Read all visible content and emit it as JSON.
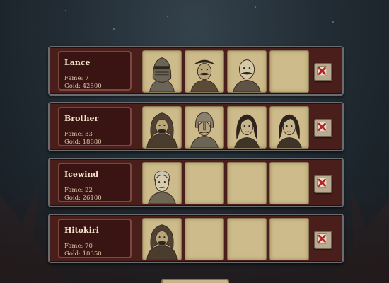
{
  "players": [
    {
      "name": "Lance",
      "fame_text": "Fame: 7",
      "gold_text": "Gold: 42500",
      "slots": [
        "helmeted-knight-portrait",
        "mustached-hat-man-portrait",
        "bald-mustache-man-portrait",
        "empty"
      ]
    },
    {
      "name": "Brother",
      "fame_text": "Fame: 33",
      "gold_text": "Gold: 18880",
      "slots": [
        "hooded-man-portrait",
        "helmeted-warrior-portrait",
        "dark-haired-woman-portrait",
        "dark-haired-woman-portrait"
      ]
    },
    {
      "name": "Icewind",
      "fame_text": "Fame: 22",
      "gold_text": "Gold: 26100",
      "slots": [
        "gray-haired-man-portrait",
        "empty",
        "empty",
        "empty"
      ]
    },
    {
      "name": "Hitokiri",
      "fame_text": "Fame: 70",
      "gold_text": "Gold: 10350",
      "slots": [
        "hooded-man-portrait",
        "empty",
        "empty",
        "empty"
      ]
    }
  ],
  "remove_icon": "red-x-icon",
  "colors": {
    "panel": "#4a1f1b",
    "slot": "#cdbb8b",
    "remove_x": "#b3242a"
  }
}
